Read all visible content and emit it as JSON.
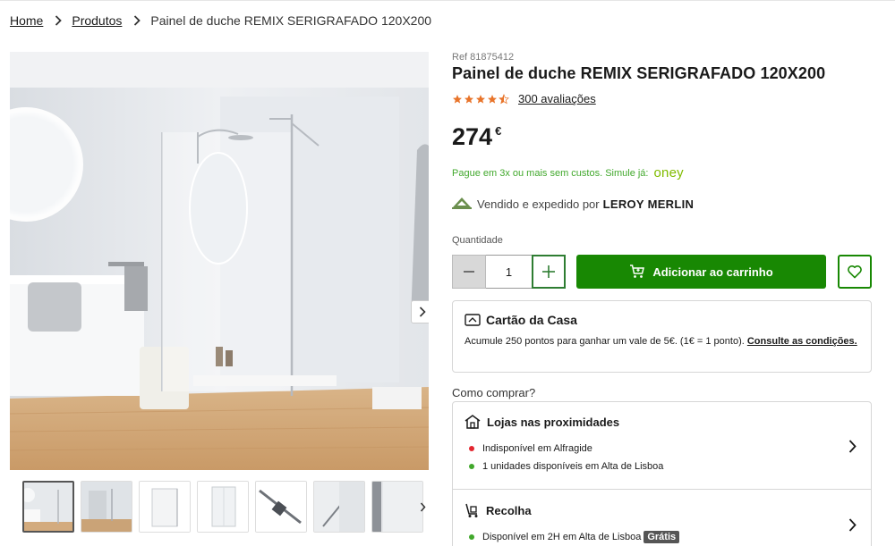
{
  "breadcrumb": {
    "items": [
      {
        "label": "Home"
      },
      {
        "label": "Produtos"
      }
    ],
    "current": "Painel de duche REMIX SERIGRAFADO 120X200"
  },
  "product": {
    "ref": "Ref 81875412",
    "title": "Painel de duche REMIX SERIGRAFADO 120X200",
    "rating": 4.5,
    "reviews_label": "300 avaliações",
    "price_int": "274",
    "currency": "€"
  },
  "oney": {
    "text": "Pague em 3x ou mais sem custos. Simule já:",
    "logo": "oney"
  },
  "seller": {
    "prefix": "Vendido e expedido por",
    "name": "LEROY MERLIN"
  },
  "quantity": {
    "label": "Quantidade",
    "value": "1"
  },
  "cart": {
    "add_label": "Adicionar ao carrinho"
  },
  "casa": {
    "title": "Cartão da Casa",
    "text": "Acumule 250 pontos para ganhar um vale de 5€. (1€ = 1 ponto).",
    "link": "Consulte as condições."
  },
  "how_to_buy": {
    "label": "Como comprar?",
    "stores": {
      "title": "Lojas nas proximidades",
      "lines": [
        {
          "text": "Indisponível em Alfragide",
          "status": "unavailable"
        },
        {
          "text": "1 unidades disponíveis em Alta de Lisboa",
          "status": "available"
        }
      ]
    },
    "recolha": {
      "title": "Recolha",
      "line": "Disponível em 2H em Alta de Lisboa",
      "badge": "Grátis"
    }
  },
  "colors": {
    "brand_green": "#188803",
    "available": "#41a82c",
    "unavailable": "#e3262f",
    "star": "#e8742a",
    "oney": "#81bc00"
  },
  "icons": {
    "breadcrumb_separator": "chevron-right-icon",
    "stars": "star-icon",
    "seller": "leroy-merlin-logo-icon",
    "minus": "minus-icon",
    "plus": "plus-icon",
    "cart": "cart-icon",
    "wishlist": "heart-icon",
    "casa": "card-icon",
    "stores": "store-icon",
    "recolha": "trolley-icon",
    "section_chevron": "chevron-right-icon"
  }
}
